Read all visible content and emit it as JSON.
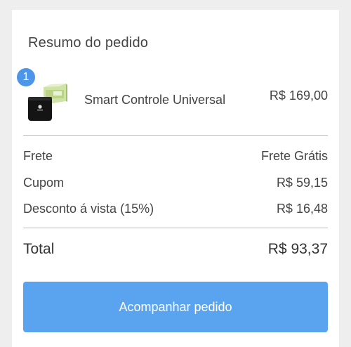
{
  "order_summary": {
    "title": "Resumo do pedido",
    "item": {
      "quantity": "1",
      "name": "Smart Controle Universal",
      "price": "R$ 169,00",
      "thumbnail_icon": "smart-remote-hub-product-image"
    },
    "lines": [
      {
        "label": "Frete",
        "value": "Frete Grátis"
      },
      {
        "label": "Cupom",
        "value": "R$ 59,15"
      },
      {
        "label": "Desconto á vista (15%)",
        "value": "R$ 16,48"
      }
    ],
    "total": {
      "label": "Total",
      "value": "R$ 93,37"
    },
    "action_label": "Acompanhar pedido"
  },
  "colors": {
    "accent": "#4d95e8",
    "button": "#5aa3ef",
    "background": "#eeeeee",
    "card": "#ffffff",
    "divider": "#bdbdbd"
  }
}
